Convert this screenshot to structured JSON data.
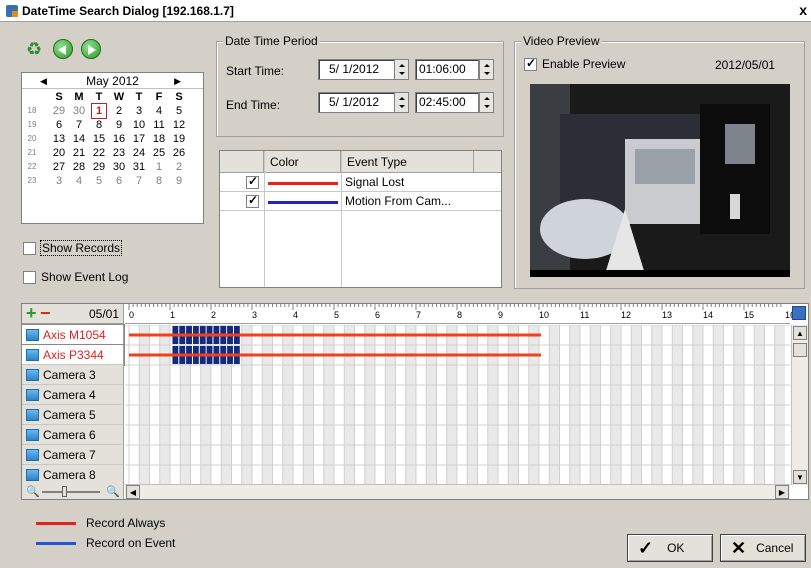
{
  "window": {
    "title": "DateTime Search Dialog  [192.168.1.7]",
    "close_glyph": "x"
  },
  "nav": {
    "refresh_icon": "refresh-icon",
    "prev_icon": "back-arrow-icon",
    "next_icon": "forward-arrow-icon"
  },
  "calendar": {
    "month_label": "May 2012",
    "weekdays": [
      "S",
      "M",
      "T",
      "W",
      "T",
      "F",
      "S"
    ],
    "weeks": [
      {
        "num": "18",
        "days": [
          {
            "d": "29",
            "m": true
          },
          {
            "d": "30",
            "m": true
          },
          {
            "d": "1",
            "today": true
          },
          {
            "d": "2"
          },
          {
            "d": "3"
          },
          {
            "d": "4"
          },
          {
            "d": "5"
          }
        ]
      },
      {
        "num": "19",
        "days": [
          {
            "d": "6"
          },
          {
            "d": "7"
          },
          {
            "d": "8"
          },
          {
            "d": "9"
          },
          {
            "d": "10"
          },
          {
            "d": "11"
          },
          {
            "d": "12"
          }
        ]
      },
      {
        "num": "20",
        "days": [
          {
            "d": "13"
          },
          {
            "d": "14"
          },
          {
            "d": "15"
          },
          {
            "d": "16"
          },
          {
            "d": "17"
          },
          {
            "d": "18"
          },
          {
            "d": "19"
          }
        ]
      },
      {
        "num": "21",
        "days": [
          {
            "d": "20"
          },
          {
            "d": "21"
          },
          {
            "d": "22"
          },
          {
            "d": "23"
          },
          {
            "d": "24"
          },
          {
            "d": "25"
          },
          {
            "d": "26"
          }
        ]
      },
      {
        "num": "22",
        "days": [
          {
            "d": "27"
          },
          {
            "d": "28"
          },
          {
            "d": "29"
          },
          {
            "d": "30"
          },
          {
            "d": "31"
          },
          {
            "d": "1",
            "m": true
          },
          {
            "d": "2",
            "m": true
          }
        ]
      },
      {
        "num": "23",
        "days": [
          {
            "d": "3",
            "m": true
          },
          {
            "d": "4",
            "m": true
          },
          {
            "d": "5",
            "m": true
          },
          {
            "d": "6",
            "m": true
          },
          {
            "d": "7",
            "m": true
          },
          {
            "d": "8",
            "m": true
          },
          {
            "d": "9",
            "m": true
          }
        ]
      }
    ]
  },
  "options": {
    "show_records": "Show Records",
    "show_event_log": "Show Event Log"
  },
  "period": {
    "legend": "Date Time Period",
    "start_label": "Start Time:",
    "start_date": "5/  1/2012",
    "start_time": "01:06:00",
    "end_label": "End Time:",
    "end_date": "5/  1/2012",
    "end_time": "02:45:00"
  },
  "events": {
    "headers": {
      "color": "Color",
      "event_type": "Event Type"
    },
    "rows": [
      {
        "type": "Signal Lost",
        "color": "#e8231a",
        "checked": true
      },
      {
        "type": "Motion From Cam...",
        "color": "#1f23c8",
        "checked": true
      }
    ]
  },
  "preview": {
    "legend": "Video Preview",
    "enable_label": "Enable Preview",
    "enabled": true,
    "date": "2012/05/01"
  },
  "timeline": {
    "date_label": "05/01",
    "ticks": [
      "0",
      "1",
      "2",
      "3",
      "4",
      "5",
      "6",
      "7",
      "8",
      "9",
      "10",
      "11",
      "12",
      "13",
      "14",
      "15",
      "16"
    ],
    "cameras": [
      {
        "name": "Axis M1054",
        "selected": true,
        "record_end_hour": 10.05,
        "event_blocks": [
          [
            1.06,
            2.75
          ]
        ]
      },
      {
        "name": "Axis P3344",
        "selected": true,
        "record_end_hour": 10.05,
        "event_blocks": [
          [
            1.06,
            2.75
          ]
        ]
      },
      {
        "name": "Camera 3"
      },
      {
        "name": "Camera 4"
      },
      {
        "name": "Camera 5"
      },
      {
        "name": "Camera 6"
      },
      {
        "name": "Camera 7"
      },
      {
        "name": "Camera 8"
      }
    ]
  },
  "legend": {
    "record_always": {
      "label": "Record Always",
      "color": "#e8231a"
    },
    "record_on_event": {
      "label": "Record on Event",
      "color": "#1f57d8"
    }
  },
  "buttons": {
    "ok": "OK",
    "cancel": "Cancel"
  },
  "colors": {
    "record_line": "#f0401c",
    "event_block": "#142a7c"
  }
}
